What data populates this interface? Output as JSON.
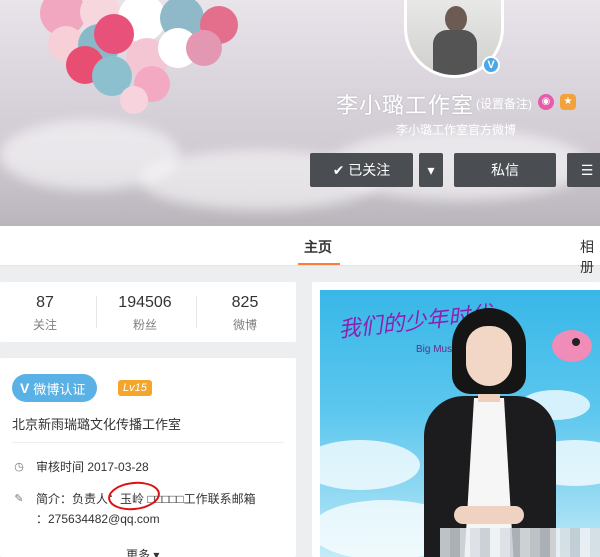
{
  "profile": {
    "name": "李小璐工作室",
    "remark_label": "(设置备注)",
    "subtitle": "李小璐工作室官方微博",
    "verify_badge": "V"
  },
  "actions": {
    "follow_label": "✔ 已关注",
    "dropdown_icon": "▾",
    "message_label": "私信",
    "more_icon": "☰"
  },
  "tabs": {
    "home": "主页",
    "photos": "相册"
  },
  "stats": [
    {
      "num": "87",
      "label": "关注"
    },
    {
      "num": "194506",
      "label": "粉丝"
    },
    {
      "num": "825",
      "label": "微博"
    }
  ],
  "info": {
    "verified_label": "微博认证",
    "verified_mark": "V",
    "level_badge": "Lv15",
    "verify_desc": "北京新雨瑞璐文化传播工作室",
    "review_label": "审核时间 2017-03-28",
    "intro_label": "简介：负责人：玉岭 □□□□□工作联系邮箱",
    "email_label": "：275634482@qq.com",
    "more_label": "更多 ▾"
  },
  "post": {
    "title": "我们的少年时代",
    "subtitle": "Big Music"
  },
  "colors": {
    "accent": "#fa7d3c",
    "button_dark": "#4a4d52",
    "verified_blue": "#5ab1e6",
    "level_orange": "#f4a52b"
  }
}
